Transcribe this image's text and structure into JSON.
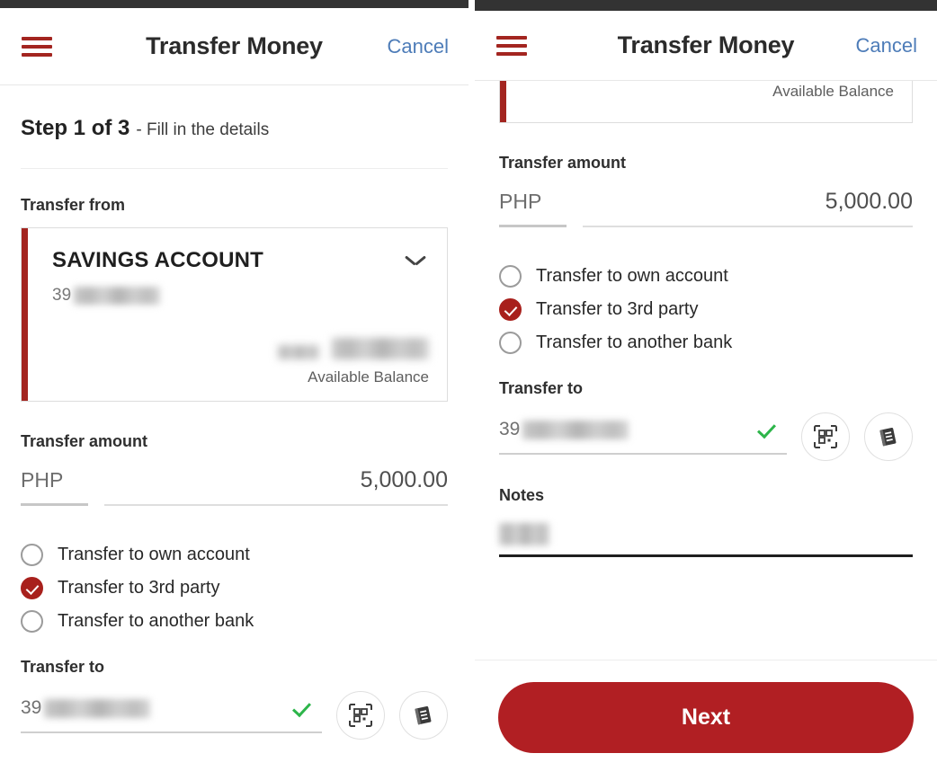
{
  "app": {
    "title": "Transfer Money",
    "cancel_label": "Cancel",
    "menu_icon": "hamburger-menu-icon",
    "brand_red": "#A32520",
    "link_blue": "#4d7cb8",
    "status_bar_color": "#333333"
  },
  "left_panel": {
    "step": {
      "strong": "Step 1 of 3",
      "rest": "- Fill in the details"
    },
    "transfer_from": {
      "label": "Transfer from",
      "account_name": "SAVINGS ACCOUNT",
      "account_number_prefix": "39",
      "account_number_redacted": true,
      "balance_redacted": true,
      "available_balance_label": "Available Balance",
      "chevron_icon": "chevron-down-icon"
    },
    "transfer_amount": {
      "label": "Transfer amount",
      "currency": "PHP",
      "value": "5,000.00"
    },
    "transfer_type": {
      "options": [
        {
          "label": "Transfer to own account",
          "selected": false
        },
        {
          "label": "Transfer to 3rd party",
          "selected": true
        },
        {
          "label": "Transfer to another bank",
          "selected": false
        }
      ]
    },
    "transfer_to": {
      "label": "Transfer to",
      "value_prefix": "39",
      "value_redacted": true,
      "valid_icon": "green-check-icon",
      "qr_icon": "qr-scan-icon",
      "addressbook_icon": "address-book-icon"
    }
  },
  "right_panel": {
    "partial_card": {
      "available_balance_label": "Available Balance"
    },
    "transfer_amount": {
      "label": "Transfer amount",
      "currency": "PHP",
      "value": "5,000.00"
    },
    "transfer_type": {
      "options": [
        {
          "label": "Transfer to own account",
          "selected": false
        },
        {
          "label": "Transfer to 3rd party",
          "selected": true
        },
        {
          "label": "Transfer to another bank",
          "selected": false
        }
      ]
    },
    "transfer_to": {
      "label": "Transfer to",
      "value_prefix": "39",
      "value_redacted": true,
      "valid_icon": "green-check-icon",
      "qr_icon": "qr-scan-icon",
      "addressbook_icon": "address-book-icon"
    },
    "notes": {
      "label": "Notes",
      "value_redacted": true
    },
    "footer": {
      "next_label": "Next"
    }
  }
}
